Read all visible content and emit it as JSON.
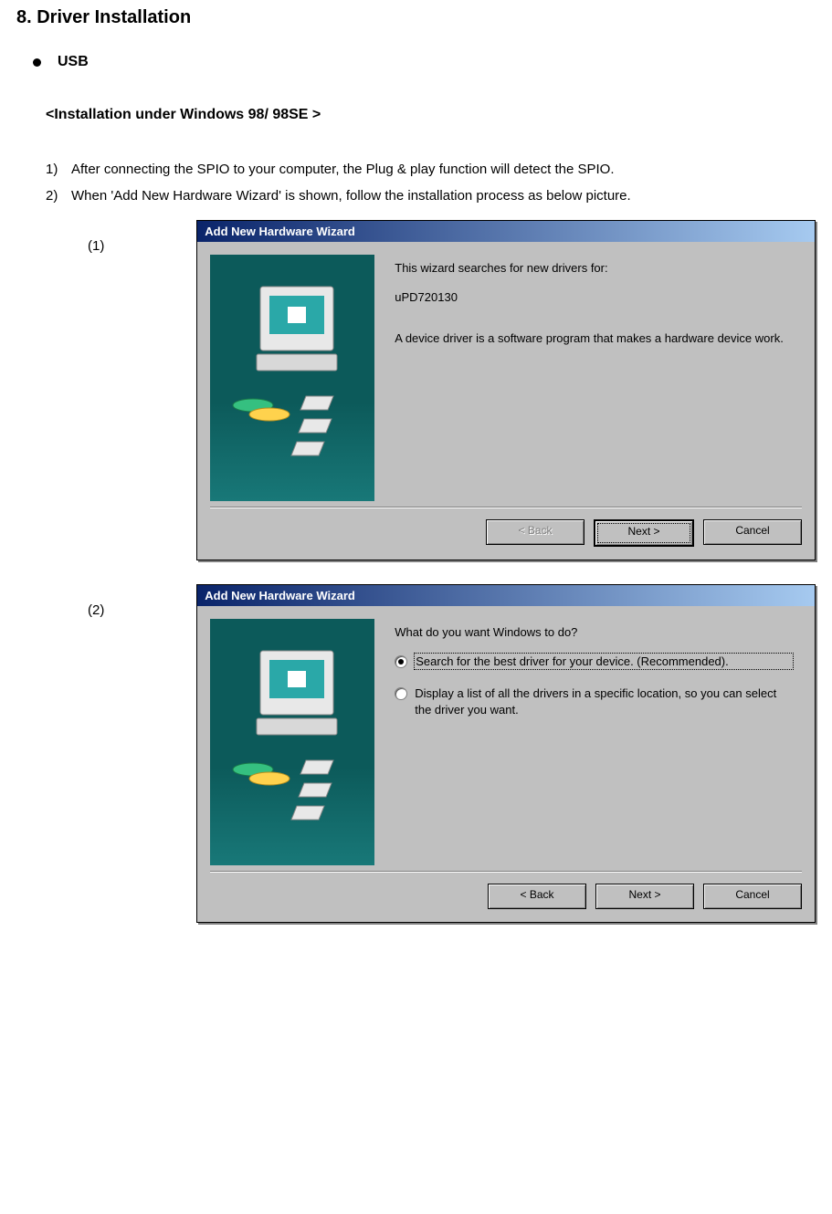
{
  "doc": {
    "section_title": "8. Driver Installation",
    "bullet": "USB",
    "subheading": "<Installation under Windows 98/ 98SE >",
    "steps": [
      "After connecting the SPIO to your computer, the Plug & play function will detect the SPIO.",
      "When 'Add New Hardware Wizard' is shown, follow the installation process as below picture."
    ],
    "shot_labels": [
      "(1)",
      "(2)"
    ]
  },
  "dialog1": {
    "title": "Add New Hardware Wizard",
    "line1": "This wizard searches for new drivers for:",
    "device": "uPD720130",
    "line2": "A device driver is a software program that makes a hardware device work.",
    "buttons": {
      "back": "< Back",
      "next": "Next >",
      "cancel": "Cancel"
    }
  },
  "dialog2": {
    "title": "Add New Hardware Wizard",
    "prompt": "What do you want Windows to do?",
    "option1": "Search for the best driver for your device. (Recommended).",
    "option2": "Display a list of all the drivers in a specific location, so you can select the driver you want.",
    "buttons": {
      "back": "< Back",
      "next": "Next >",
      "cancel": "Cancel"
    }
  }
}
